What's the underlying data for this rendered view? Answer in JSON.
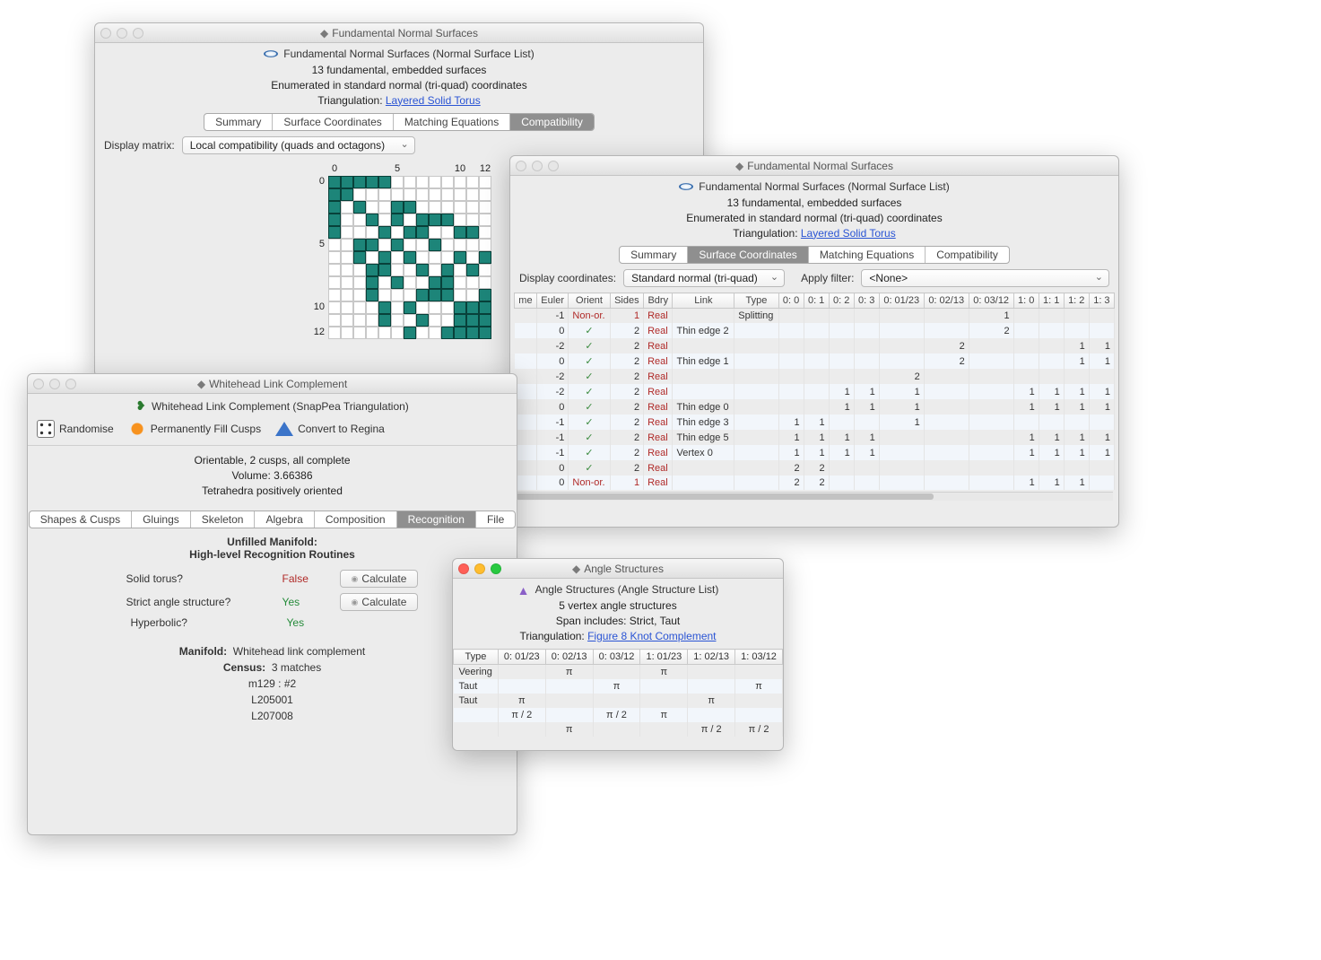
{
  "win1": {
    "title": "Fundamental Normal Surfaces",
    "header": "Fundamental Normal Surfaces (Normal Surface List)",
    "summary1": "13 fundamental, embedded surfaces",
    "summary2": "Enumerated in standard normal (tri-quad) coordinates",
    "summary3_prefix": "Triangulation: ",
    "summary3_link": "Layered Solid Torus",
    "tabs": [
      "Summary",
      "Surface Coordinates",
      "Matching Equations",
      "Compatibility"
    ],
    "active_tab": 3,
    "matrix_label": "Display matrix:",
    "matrix_select": "Local compatibility (quads and octagons)",
    "axis_ticks": {
      "0": "0",
      "5": "5",
      "10": "10",
      "12": "12"
    },
    "n": 13,
    "on": [
      [
        0,
        0
      ],
      [
        0,
        1
      ],
      [
        0,
        2
      ],
      [
        0,
        3
      ],
      [
        0,
        4
      ],
      [
        1,
        0
      ],
      [
        1,
        1
      ],
      [
        2,
        0
      ],
      [
        2,
        2
      ],
      [
        2,
        5
      ],
      [
        2,
        6
      ],
      [
        3,
        0
      ],
      [
        3,
        3
      ],
      [
        3,
        5
      ],
      [
        3,
        7
      ],
      [
        3,
        8
      ],
      [
        3,
        9
      ],
      [
        4,
        0
      ],
      [
        4,
        4
      ],
      [
        4,
        6
      ],
      [
        4,
        7
      ],
      [
        4,
        10
      ],
      [
        4,
        11
      ],
      [
        5,
        2
      ],
      [
        5,
        3
      ],
      [
        5,
        5
      ],
      [
        5,
        8
      ],
      [
        6,
        2
      ],
      [
        6,
        4
      ],
      [
        6,
        6
      ],
      [
        6,
        10
      ],
      [
        6,
        12
      ],
      [
        7,
        3
      ],
      [
        7,
        4
      ],
      [
        7,
        7
      ],
      [
        7,
        9
      ],
      [
        7,
        11
      ],
      [
        8,
        3
      ],
      [
        8,
        5
      ],
      [
        8,
        8
      ],
      [
        8,
        9
      ],
      [
        9,
        3
      ],
      [
        9,
        7
      ],
      [
        9,
        8
      ],
      [
        9,
        9
      ],
      [
        9,
        12
      ],
      [
        10,
        4
      ],
      [
        10,
        6
      ],
      [
        10,
        10
      ],
      [
        10,
        11
      ],
      [
        10,
        12
      ],
      [
        11,
        4
      ],
      [
        11,
        7
      ],
      [
        11,
        10
      ],
      [
        11,
        11
      ],
      [
        11,
        12
      ],
      [
        12,
        6
      ],
      [
        12,
        9
      ],
      [
        12,
        10
      ],
      [
        12,
        11
      ],
      [
        12,
        12
      ]
    ]
  },
  "win2": {
    "title": "Fundamental Normal Surfaces",
    "header": "Fundamental Normal Surfaces (Normal Surface List)",
    "summary1": "13 fundamental, embedded surfaces",
    "summary2": "Enumerated in standard normal (tri-quad) coordinates",
    "summary3_prefix": "Triangulation: ",
    "summary3_link": "Layered Solid Torus",
    "tabs": [
      "Summary",
      "Surface Coordinates",
      "Matching Equations",
      "Compatibility"
    ],
    "active_tab": 1,
    "coord_label": "Display coordinates:",
    "coord_select": "Standard normal (tri-quad)",
    "filter_label": "Apply filter:",
    "filter_select": "<None>",
    "cols": [
      "me",
      "Euler",
      "Orient",
      "Sides",
      "Bdry",
      "Link",
      "Type",
      "0: 0",
      "0: 1",
      "0: 2",
      "0: 3",
      "0: 01/23",
      "0: 02/13",
      "0: 03/12",
      "1: 0",
      "1: 1",
      "1: 2",
      "1: 3"
    ],
    "rows": [
      {
        "euler": "-1",
        "orient": "Non-or.",
        "sides": "1",
        "bdry": "Real",
        "link": "",
        "type": "Splitting",
        "c": [
          "",
          "",
          "",
          "",
          "",
          "",
          "1",
          "",
          "",
          "",
          ""
        ]
      },
      {
        "euler": "0",
        "orient": "✓",
        "sides": "2",
        "bdry": "Real",
        "link": "Thin edge 2",
        "type": "",
        "c": [
          "",
          "",
          "",
          "",
          "",
          "",
          "2",
          "",
          "",
          "",
          ""
        ]
      },
      {
        "euler": "-2",
        "orient": "✓",
        "sides": "2",
        "bdry": "Real",
        "link": "",
        "type": "",
        "c": [
          "",
          "",
          "",
          "",
          "",
          "2",
          "",
          "",
          "",
          "1",
          "1"
        ]
      },
      {
        "euler": "0",
        "orient": "✓",
        "sides": "2",
        "bdry": "Real",
        "link": "Thin edge 1",
        "type": "",
        "c": [
          "",
          "",
          "",
          "",
          "",
          "2",
          "",
          "",
          "",
          "1",
          "1"
        ]
      },
      {
        "euler": "-2",
        "orient": "✓",
        "sides": "2",
        "bdry": "Real",
        "link": "",
        "type": "",
        "c": [
          "",
          "",
          "",
          "",
          "2",
          "",
          "",
          "",
          "",
          "",
          ""
        ]
      },
      {
        "euler": "-2",
        "orient": "✓",
        "sides": "2",
        "bdry": "Real",
        "link": "",
        "type": "",
        "c": [
          "",
          "",
          "1",
          "1",
          "1",
          "",
          "",
          "1",
          "1",
          "1",
          "1"
        ]
      },
      {
        "euler": "0",
        "orient": "✓",
        "sides": "2",
        "bdry": "Real",
        "link": "Thin edge 0",
        "type": "",
        "c": [
          "",
          "",
          "1",
          "1",
          "1",
          "",
          "",
          "1",
          "1",
          "1",
          "1"
        ]
      },
      {
        "euler": "-1",
        "orient": "✓",
        "sides": "2",
        "bdry": "Real",
        "link": "Thin edge 3",
        "type": "",
        "c": [
          "1",
          "1",
          "",
          "",
          "1",
          "",
          "",
          "",
          "",
          "",
          ""
        ]
      },
      {
        "euler": "-1",
        "orient": "✓",
        "sides": "2",
        "bdry": "Real",
        "link": "Thin edge 5",
        "type": "",
        "c": [
          "1",
          "1",
          "1",
          "1",
          "",
          "",
          "",
          "1",
          "1",
          "1",
          "1"
        ]
      },
      {
        "euler": "-1",
        "orient": "✓",
        "sides": "2",
        "bdry": "Real",
        "link": "Vertex 0",
        "type": "",
        "c": [
          "1",
          "1",
          "1",
          "1",
          "",
          "",
          "",
          "1",
          "1",
          "1",
          "1"
        ]
      },
      {
        "euler": "0",
        "orient": "✓",
        "sides": "2",
        "bdry": "Real",
        "link": "",
        "type": "",
        "c": [
          "2",
          "2",
          "",
          "",
          "",
          "",
          "",
          "",
          "",
          "",
          ""
        ]
      },
      {
        "euler": "0",
        "orient": "Non-or.",
        "sides": "1",
        "bdry": "Real",
        "link": "",
        "type": "",
        "c": [
          "2",
          "2",
          "",
          "",
          "",
          "",
          "",
          "1",
          "1",
          "1",
          ""
        ]
      }
    ]
  },
  "win3": {
    "title": "Whitehead Link Complement",
    "header": "Whitehead Link Complement (SnapPea Triangulation)",
    "tools": {
      "randomise": "Randomise",
      "fill": "Permanently Fill Cusps",
      "convert": "Convert to Regina"
    },
    "info1": "Orientable, 2 cusps, all complete",
    "info2": "Volume: 3.66386",
    "info3": "Tetrahedra positively oriented",
    "tabs": [
      "Shapes & Cusps",
      "Gluings",
      "Skeleton",
      "Algebra",
      "Composition",
      "Recognition",
      "File"
    ],
    "active_tab": 5,
    "recog_title1": "Unfilled Manifold:",
    "recog_title2": "High-level Recognition Routines",
    "q1": "Solid torus?",
    "a1": "False",
    "q2": "Strict angle structure?",
    "a2": "Yes",
    "q3": "Hyperbolic?",
    "a3": "Yes",
    "calc": "Calculate",
    "manifold_lbl": "Manifold:",
    "manifold_val": "Whitehead link complement",
    "census_lbl": "Census:",
    "census_val": "3 matches",
    "census1": "m129 : #2",
    "census2": "L205001",
    "census3": "L207008"
  },
  "win4": {
    "title": "Angle Structures",
    "header": "Angle Structures (Angle Structure List)",
    "summary1": "5 vertex angle structures",
    "summary2": "Span includes: Strict, Taut",
    "summary3_prefix": "Triangulation: ",
    "summary3_link": "Figure 8 Knot Complement",
    "cols": [
      "Type",
      "0: 01/23",
      "0: 02/13",
      "0: 03/12",
      "1: 01/23",
      "1: 02/13",
      "1: 03/12"
    ],
    "rows": [
      {
        "t": "Veering",
        "c": [
          "",
          "π",
          "",
          "π",
          "",
          ""
        ]
      },
      {
        "t": "Taut",
        "c": [
          "",
          "",
          "π",
          "",
          "",
          "π"
        ]
      },
      {
        "t": "Taut",
        "c": [
          "π",
          "",
          "",
          "",
          "π",
          ""
        ]
      },
      {
        "t": "",
        "c": [
          "π / 2",
          "",
          "π / 2",
          "π",
          "",
          ""
        ]
      },
      {
        "t": "",
        "c": [
          "",
          "π",
          "",
          "",
          "π / 2",
          "π / 2"
        ]
      }
    ]
  }
}
